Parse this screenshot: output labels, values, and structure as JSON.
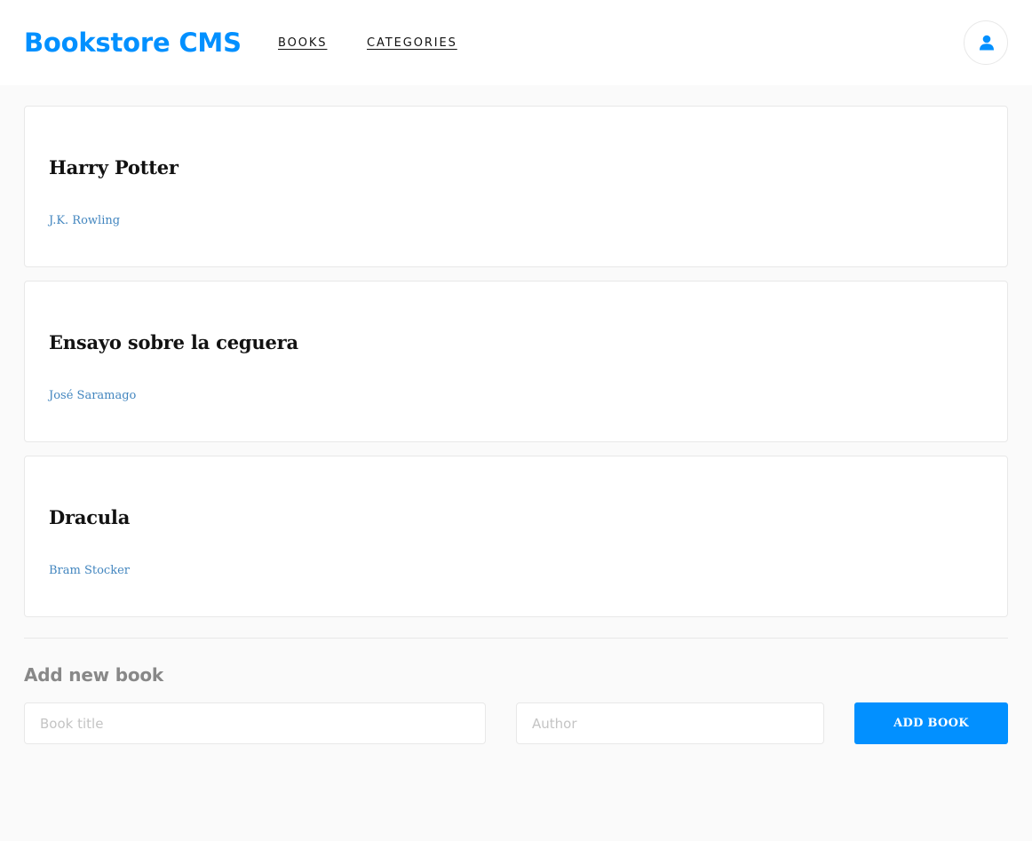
{
  "header": {
    "logo": "Bookstore CMS",
    "nav": [
      {
        "label": "BOOKS"
      },
      {
        "label": "CATEGORIES"
      }
    ],
    "user_icon": "user-icon"
  },
  "books": [
    {
      "title": "Harry Potter",
      "author": "J.K. Rowling"
    },
    {
      "title": "Ensayo sobre la ceguera",
      "author": "José Saramago"
    },
    {
      "title": "Dracula",
      "author": "Bram Stocker"
    }
  ],
  "form": {
    "title": "Add new book",
    "title_placeholder": "Book title",
    "author_placeholder": "Author",
    "submit_label": "ADD BOOK"
  },
  "colors": {
    "accent": "#0290ff",
    "author_link": "#4386bf",
    "background": "#fafafa"
  }
}
